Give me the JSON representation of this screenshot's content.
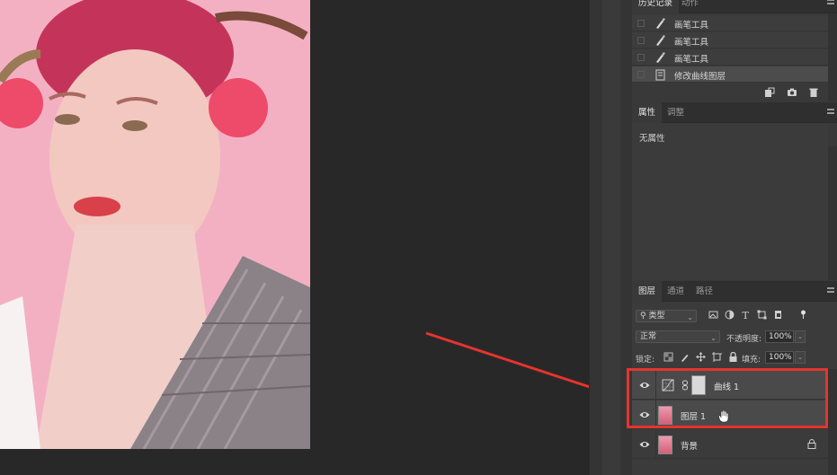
{
  "history_panel": {
    "tabs": [
      "历史记录",
      "动作"
    ],
    "items": [
      {
        "label": "画笔工具",
        "icon": "brush-icon",
        "selected": false
      },
      {
        "label": "画笔工具",
        "icon": "brush-icon",
        "selected": false
      },
      {
        "label": "画笔工具",
        "icon": "brush-icon",
        "selected": false
      },
      {
        "label": "修改曲线图层",
        "icon": "document-icon",
        "selected": true
      }
    ],
    "footer_icons": [
      "new-document-from-state-icon",
      "camera-icon",
      "trash-icon"
    ]
  },
  "properties_panel": {
    "tabs": [
      "属性",
      "调整"
    ],
    "empty_label": "无属性"
  },
  "layers_panel": {
    "tabs": [
      "图层",
      "通道",
      "路径"
    ],
    "filter_label": "类型",
    "blend_mode": "正常",
    "opacity_label": "不透明度:",
    "opacity_value": "100%",
    "lock_label": "锁定:",
    "fill_label": "填充:",
    "fill_value": "100%",
    "layers": [
      {
        "name": "曲线 1",
        "kind": "adjustment-curves",
        "visible": true
      },
      {
        "name": "图层 1",
        "kind": "pixel",
        "visible": true
      },
      {
        "name": "背景",
        "kind": "background",
        "visible": true,
        "locked": true
      }
    ]
  },
  "colors": {
    "annotation_red": "#e5342e",
    "panel_bg": "#393939",
    "canvas_bg": "#282828"
  }
}
